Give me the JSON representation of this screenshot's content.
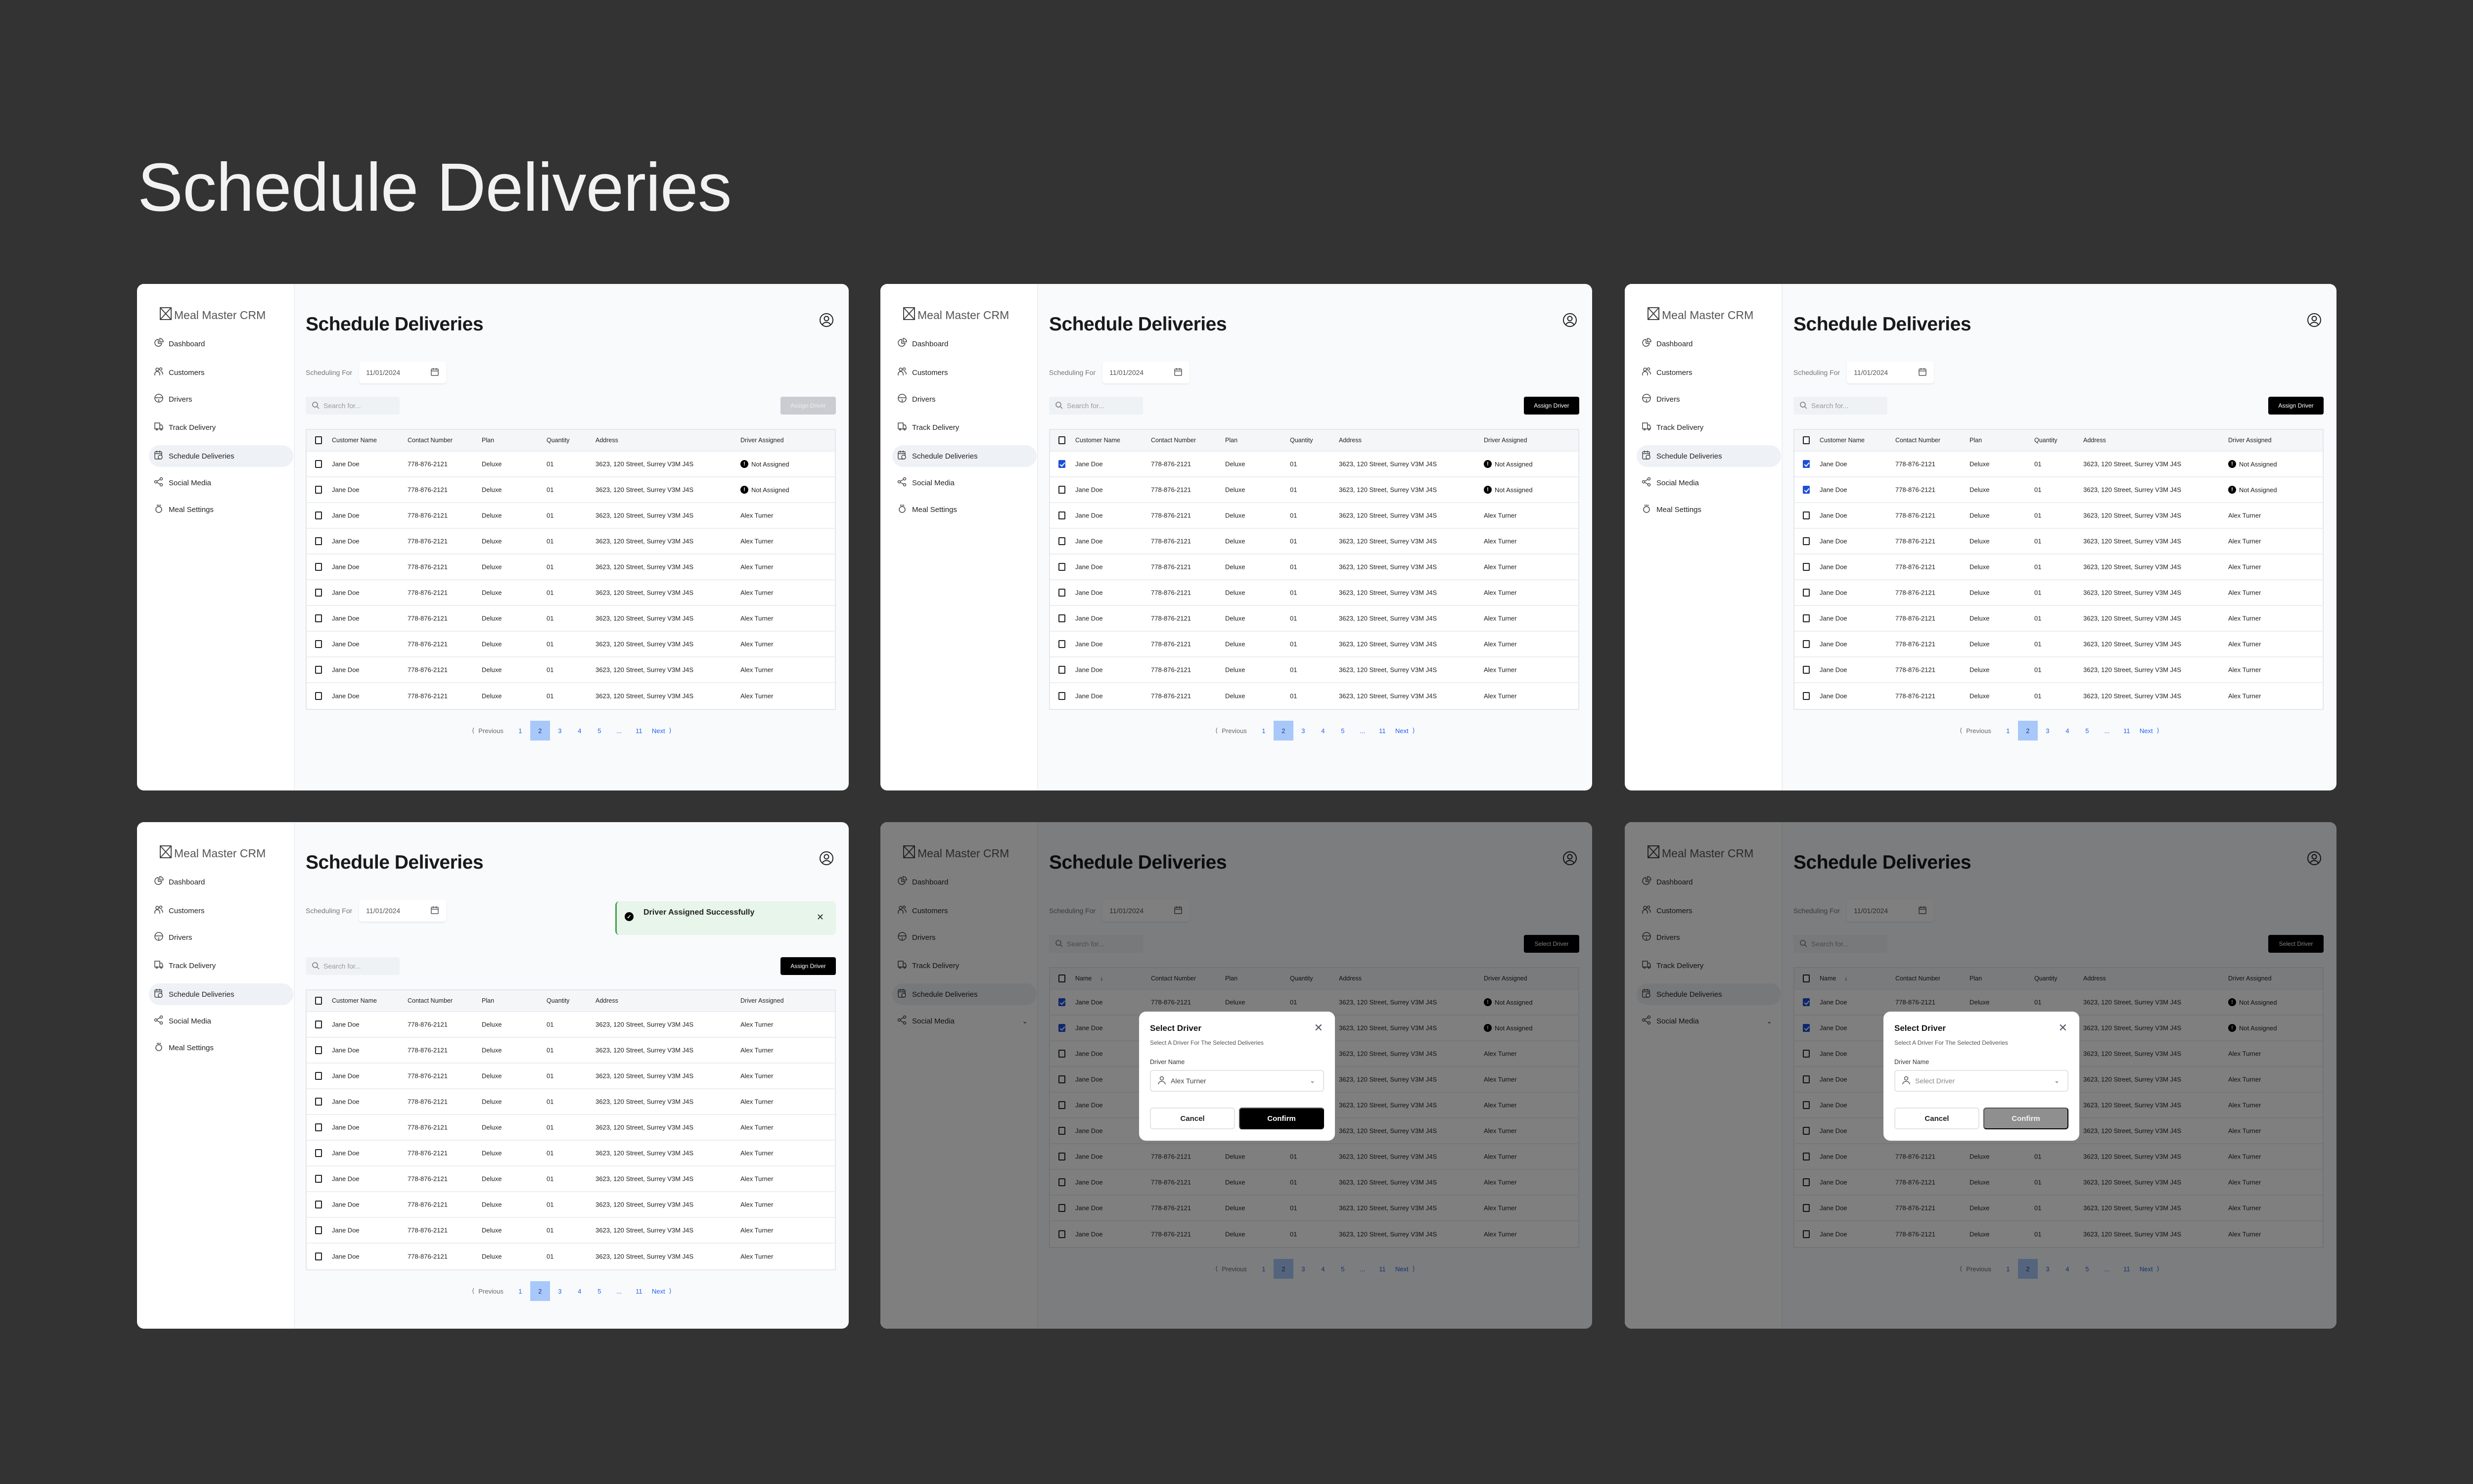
{
  "page_title": "Schedule Deliveries",
  "app": {
    "logo": "Meal Master CRM"
  },
  "nav_full": [
    "Dashboard",
    "Customers",
    "Drivers",
    "Track Delivery",
    "Schedule Deliveries",
    "Social Media",
    "Meal Settings"
  ],
  "nav_modal": [
    "Dashboard",
    "Customers",
    "Drivers",
    "Track Delivery",
    "Schedule Deliveries",
    "Social Media"
  ],
  "nav_icons": [
    "pie-chart-icon",
    "users-icon",
    "steering-wheel-icon",
    "truck-icon",
    "calendar-clock-icon",
    "share-icon",
    "meal-settings-icon"
  ],
  "header": {
    "title": "Schedule Deliveries",
    "scheduling_label": "Scheduling For",
    "date": "11/01/2024",
    "search_placeholder": "Search for..."
  },
  "table": {
    "columns": [
      "Customer Name",
      "Contact Number",
      "Plan",
      "Quantity",
      "Address",
      "Driver Assigned"
    ],
    "sorted_first_column": "Name",
    "rows": [
      {
        "name": "Jane Doe",
        "contact": "778-876-2121",
        "plan": "Deluxe",
        "quantity": "01",
        "address": "3623, 120 Street, Surrey V3M J4S"
      },
      {
        "name": "Jane Doe",
        "contact": "778-876-2121",
        "plan": "Deluxe",
        "quantity": "01",
        "address": "3623, 120 Street, Surrey V3M J4S"
      },
      {
        "name": "Jane Doe",
        "contact": "778-876-2121",
        "plan": "Deluxe",
        "quantity": "01",
        "address": "3623, 120 Street, Surrey V3M J4S"
      },
      {
        "name": "Jane Doe",
        "contact": "778-876-2121",
        "plan": "Deluxe",
        "quantity": "01",
        "address": "3623, 120 Street, Surrey V3M J4S"
      },
      {
        "name": "Jane Doe",
        "contact": "778-876-2121",
        "plan": "Deluxe",
        "quantity": "01",
        "address": "3623, 120 Street, Surrey V3M J4S"
      },
      {
        "name": "Jane Doe",
        "contact": "778-876-2121",
        "plan": "Deluxe",
        "quantity": "01",
        "address": "3623, 120 Street, Surrey V3M J4S"
      },
      {
        "name": "Jane Doe",
        "contact": "778-876-2121",
        "plan": "Deluxe",
        "quantity": "01",
        "address": "3623, 120 Street, Surrey V3M J4S"
      },
      {
        "name": "Jane Doe",
        "contact": "778-876-2121",
        "plan": "Deluxe",
        "quantity": "01",
        "address": "3623, 120 Street, Surrey V3M J4S"
      },
      {
        "name": "Jane Doe",
        "contact": "778-876-2121",
        "plan": "Deluxe",
        "quantity": "01",
        "address": "3623, 120 Street, Surrey V3M J4S"
      },
      {
        "name": "Jane Doe",
        "contact": "778-876-2121",
        "plan": "Deluxe",
        "quantity": "01",
        "address": "3623, 120 Street, Surrey V3M J4S"
      }
    ]
  },
  "pagination": {
    "previous": "Previous",
    "pages": [
      "1",
      "2",
      "3",
      "4",
      "5",
      "...",
      "11"
    ],
    "current": "2",
    "next": "Next"
  },
  "toast": {
    "message": "Driver Assigned Successfully"
  },
  "modal": {
    "title": "Select Driver",
    "subtitle": "Select A Driver For The Selected Deliveries",
    "field_label": "Driver Name",
    "cancel": "Cancel",
    "confirm": "Confirm"
  },
  "colors": {
    "background": "#333333",
    "accent_blue": "#2563eb",
    "checkbox_checked": "#1d4ed8",
    "page_active": "#a8c8fa",
    "toast_bg": "#e8f5ea",
    "toast_border": "#3fa34d"
  },
  "screens": [
    {
      "nav": "full",
      "action_label": "Assign Driver",
      "action_enabled": false,
      "checked": [
        false,
        false,
        false,
        false,
        false,
        false,
        false,
        false,
        false,
        false
      ],
      "drivers": [
        "Not Assigned",
        "Not Assigned",
        "Alex Turner",
        "Alex Turner",
        "Alex Turner",
        "Alex Turner",
        "Alex Turner",
        "Alex Turner",
        "Alex Turner",
        "Alex Turner"
      ]
    },
    {
      "nav": "full",
      "action_label": "Assign Driver",
      "action_enabled": true,
      "checked": [
        true,
        false,
        false,
        false,
        false,
        false,
        false,
        false,
        false,
        false
      ],
      "drivers": [
        "Not Assigned",
        "Not Assigned",
        "Alex Turner",
        "Alex Turner",
        "Alex Turner",
        "Alex Turner",
        "Alex Turner",
        "Alex Turner",
        "Alex Turner",
        "Alex Turner"
      ]
    },
    {
      "nav": "full",
      "action_label": "Assign Driver",
      "action_enabled": true,
      "checked": [
        true,
        true,
        false,
        false,
        false,
        false,
        false,
        false,
        false,
        false
      ],
      "drivers": [
        "Not Assigned",
        "Not Assigned",
        "Alex Turner",
        "Alex Turner",
        "Alex Turner",
        "Alex Turner",
        "Alex Turner",
        "Alex Turner",
        "Alex Turner",
        "Alex Turner"
      ]
    },
    {
      "nav": "full",
      "action_label": "Assign Driver",
      "action_enabled": true,
      "toast": true,
      "checked": [
        false,
        false,
        false,
        false,
        false,
        false,
        false,
        false,
        false,
        false
      ],
      "drivers": [
        "Alex Turner",
        "Alex Turner",
        "Alex Turner",
        "Alex Turner",
        "Alex Turner",
        "Alex Turner",
        "Alex Turner",
        "Alex Turner",
        "Alex Turner",
        "Alex Turner"
      ]
    },
    {
      "nav": "modal",
      "action_label": "Select Driver",
      "action_enabled": true,
      "modal": true,
      "modal_value": "Alex Turner",
      "confirm_enabled": true,
      "checked": [
        true,
        true,
        false,
        false,
        false,
        false,
        false,
        false,
        false,
        false
      ],
      "drivers": [
        "Not Assigned",
        "Not Assigned",
        "Alex Turner",
        "Alex Turner",
        "Alex Turner",
        "Alex Turner",
        "Alex Turner",
        "Alex Turner",
        "Alex Turner",
        "Alex Turner"
      ]
    },
    {
      "nav": "modal",
      "action_label": "Select Driver",
      "action_enabled": true,
      "modal": true,
      "modal_placeholder": "Select Driver",
      "confirm_enabled": false,
      "checked": [
        true,
        true,
        false,
        false,
        false,
        false,
        false,
        false,
        false,
        false
      ],
      "drivers": [
        "Not Assigned",
        "Not Assigned",
        "Alex Turner",
        "Alex Turner",
        "Alex Turner",
        "Alex Turner",
        "Alex Turner",
        "Alex Turner",
        "Alex Turner",
        "Alex Turner"
      ]
    }
  ]
}
